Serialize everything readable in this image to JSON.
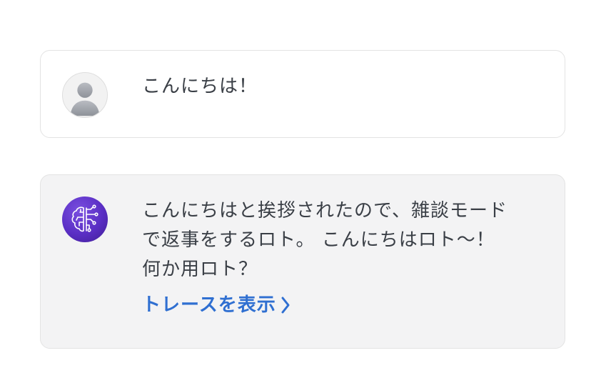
{
  "messages": {
    "user": {
      "avatar_icon": "user-silhouette-icon",
      "text": "こんにちは！"
    },
    "bot": {
      "avatar_icon": "ai-brain-circuit-icon",
      "avatar_color": "#5a2ec4",
      "lines": [
        "こんにちはと挨拶されたので、雑談モード",
        "で返事をするロト。 こんにちはロト〜！",
        "何か用ロト？"
      ],
      "trace_link_label": "トレースを表示",
      "trace_link_icon": "chevron-right-icon",
      "trace_link_color": "#2f6fd1"
    }
  }
}
